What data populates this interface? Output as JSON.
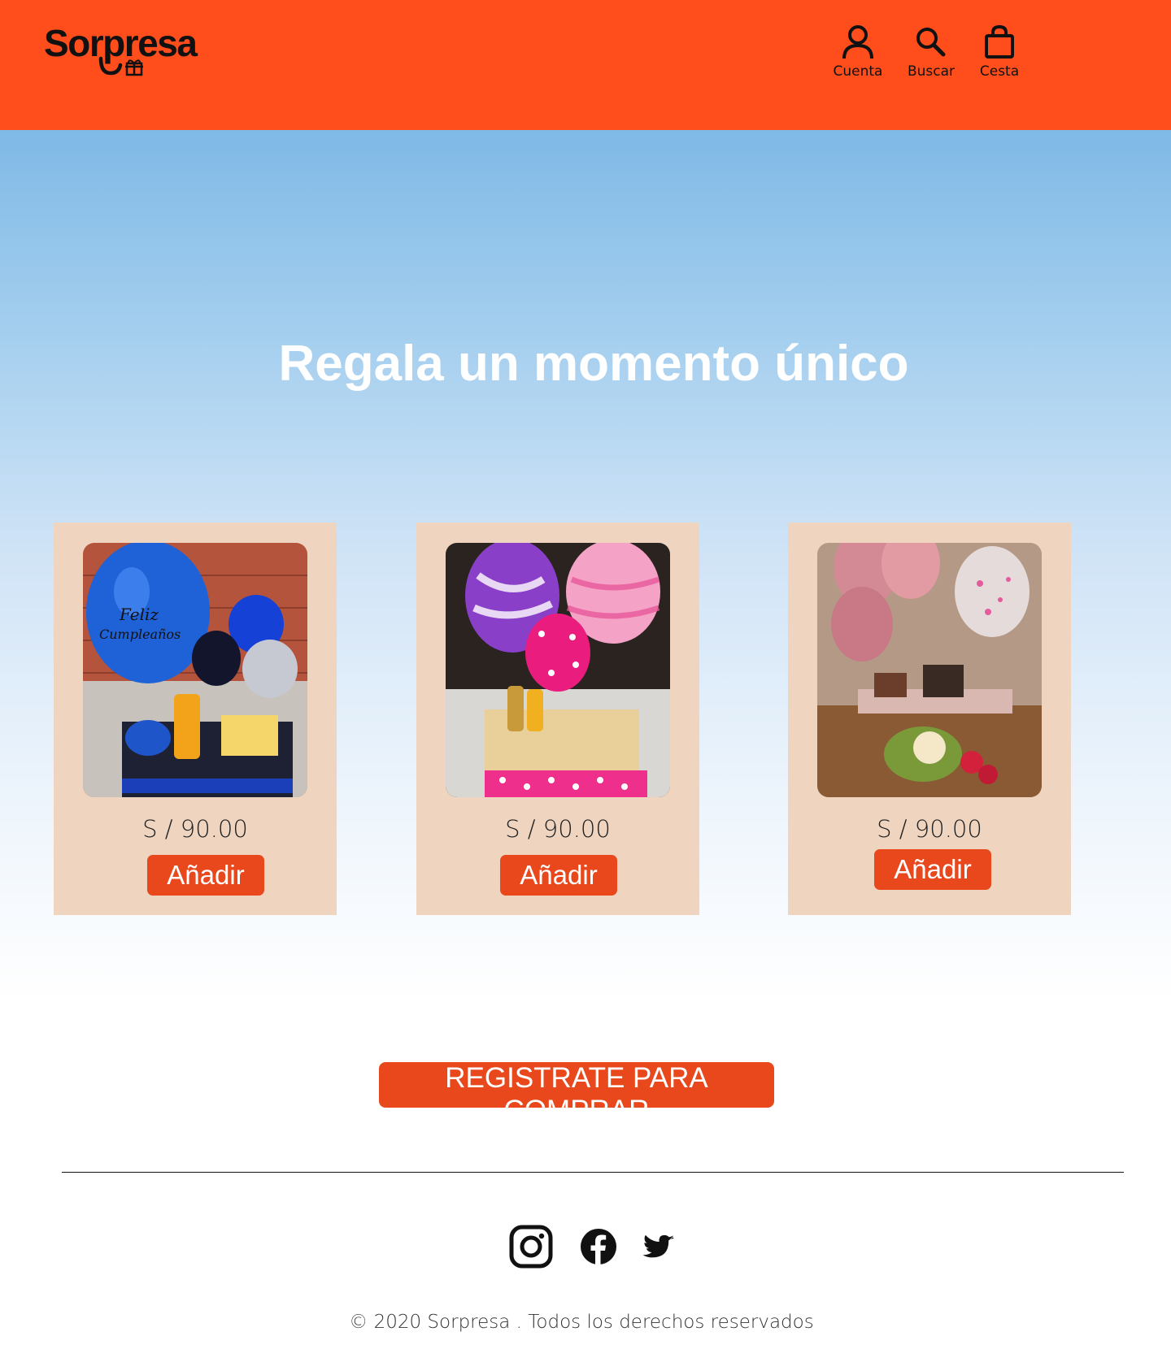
{
  "brand": {
    "name": "Sorpresa",
    "color": "#ff4e1c"
  },
  "nav": {
    "account": {
      "label": "Cuenta",
      "icon": "user-icon"
    },
    "search": {
      "label": "Buscar",
      "icon": "search-icon"
    },
    "cart": {
      "label": "Cesta",
      "icon": "shopping-bag-icon"
    }
  },
  "hero": {
    "title": "Regala un momento único"
  },
  "products": [
    {
      "image": "blue-birthday-balloon-gift-basket",
      "price": "S / 90.00",
      "button": "Añadir"
    },
    {
      "image": "pink-purple-birthday-balloon-tray",
      "price": "S / 90.00",
      "button": "Añadir"
    },
    {
      "image": "rose-gold-balloons-breakfast-gift",
      "price": "S / 90.00",
      "button": "Añadir"
    }
  ],
  "cta": {
    "register": "REGISTRATE PARA COMPRAR"
  },
  "footer": {
    "social": [
      "instagram-icon",
      "facebook-icon",
      "twitter-icon"
    ],
    "copyright": "© 2020 Sorpresa . Todos los derechos reservados"
  },
  "colors": {
    "accent": "#e8481c",
    "card": "#efd5bf",
    "hero_top": "#7fb9e6"
  }
}
